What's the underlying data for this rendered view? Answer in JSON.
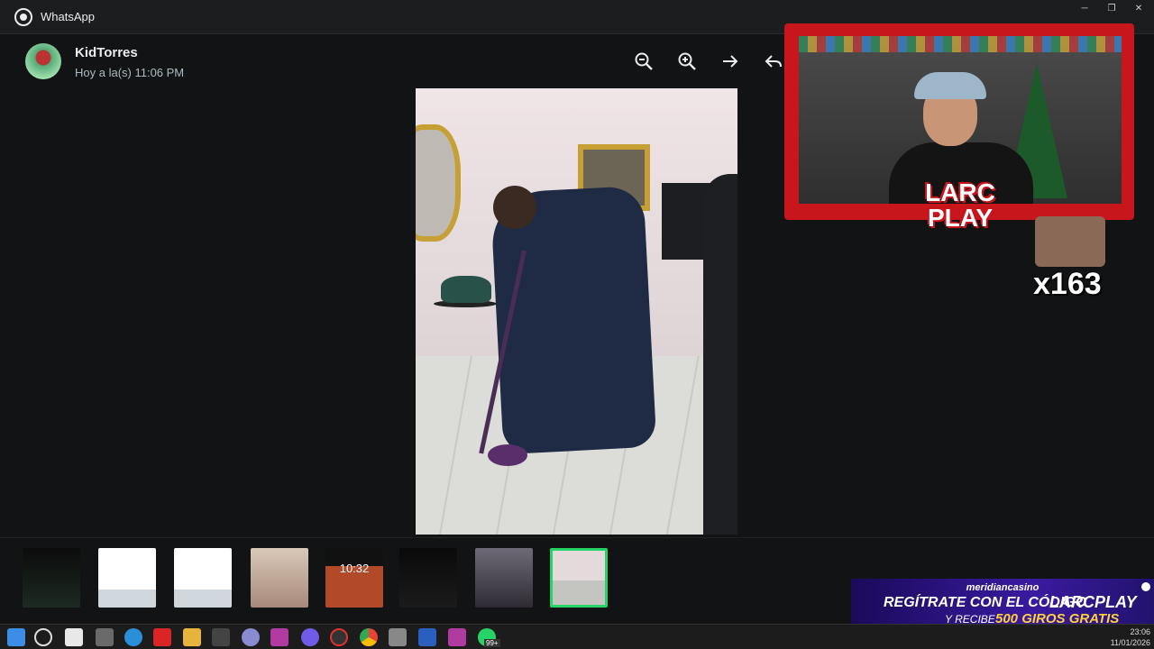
{
  "app": {
    "title": "WhatsApp"
  },
  "window_controls": {
    "minimize": "─",
    "restore": "❐",
    "close": "✕"
  },
  "header": {
    "sender": "KidTorres",
    "timestamp": "Hoy a la(s) 11:06 PM"
  },
  "toolbar": {
    "zoom_out_icon": "zoom-out-icon",
    "zoom_in_icon": "zoom-in-icon",
    "forward_icon": "arrow-right-icon",
    "reply_icon": "reply-icon"
  },
  "overlay": {
    "brand": "LARC PLAY",
    "emote_count": "x163"
  },
  "thumbnails": [
    {
      "kind": "dark-photo",
      "label": ""
    },
    {
      "kind": "document",
      "label": ""
    },
    {
      "kind": "document",
      "label": ""
    },
    {
      "kind": "photo",
      "label": ""
    },
    {
      "kind": "screenshot",
      "label": "10:32"
    },
    {
      "kind": "flyer",
      "label": ""
    },
    {
      "kind": "group-photo",
      "label": ""
    },
    {
      "kind": "current-photo",
      "label": "",
      "selected": true
    }
  ],
  "banner": {
    "brand": "meridiancasino",
    "line1": "REGÍTRATE CON EL CÓDIGO",
    "code": "LARCPLAY",
    "line2a": "Y RECIBE",
    "line2b": "500 GIROS GRATIS"
  },
  "taskbar": {
    "badge": "99+",
    "date": "11/01/2026",
    "time": "23:06"
  },
  "colors": {
    "accent": "#25d366",
    "overlay_red": "#c8161d"
  }
}
